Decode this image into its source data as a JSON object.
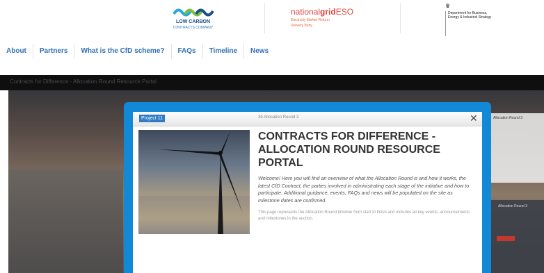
{
  "header": {
    "lcc_logo_text": "LOW CARBON",
    "lcc_logo_sub": "CONTRACTS COMPANY",
    "ng_logo_a": "national",
    "ng_logo_b": "grid",
    "ng_logo_c": "ESO",
    "ng_logo_sub1": "Electricity Market Reform",
    "ng_logo_sub2": "Delivery Body",
    "gov_logo_text": "Department for Business, Energy & Industrial Strategy"
  },
  "nav": {
    "items": [
      "About",
      "Partners",
      "What is the CfD scheme?",
      "FAQs",
      "Timeline",
      "News"
    ]
  },
  "hero": {
    "caption": "Contracts for Difference - Allocation Round Resource Portal",
    "side_text": "Allocation Round 3",
    "side_text_2": "Allocation Round 3"
  },
  "modal": {
    "tag": "Project 11",
    "round_label": "3b Allocation Round 3",
    "close": "✕",
    "title": "CONTRACTS FOR DIFFERENCE - ALLOCATION ROUND RESOURCE PORTAL",
    "intro": "Welcome! Here you will find an overview of what the Allocation Round is and how it works, the latest CfD Contract, the parties involved in administrating each stage of the initiative and how to participate. Additional guidance, events, FAQs and news will be populated on the site as milestone dates are confirmed.",
    "body": "This page represents the Allocation Round timeline from start to finish and includes all key events, announcements and milestones in the auction."
  },
  "colors": {
    "accent": "#1289d6",
    "nav": "#2f6fb7",
    "brand_red": "#e04646"
  }
}
